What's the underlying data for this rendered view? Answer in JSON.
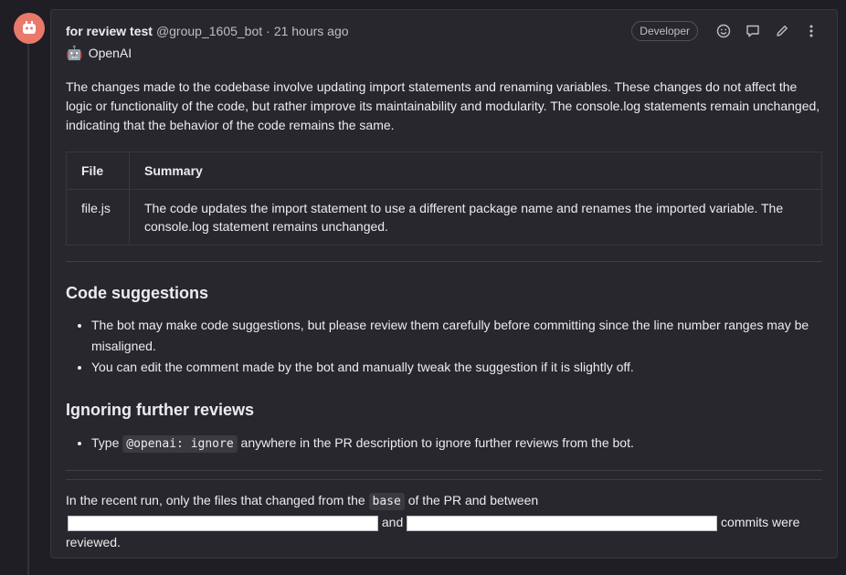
{
  "comment": {
    "author_name": "for review test",
    "author_handle": "@group_1605_bot",
    "separator": "·",
    "time": "21 hours ago",
    "role_badge": "Developer",
    "bot_emoji": "🤖",
    "bot_label": "OpenAI",
    "intro": "The changes made to the codebase involve updating import statements and renaming variables. These changes do not affect the logic or functionality of the code, but rather improve its maintainability and modularity. The console.log statements remain unchanged, indicating that the behavior of the code remains the same.",
    "table": {
      "headers": [
        "File",
        "Summary"
      ],
      "rows": [
        [
          "file.js",
          "The code updates the import statement to use a different package name and renames the imported variable. The console.log statement remains unchanged."
        ]
      ]
    },
    "code_suggestions": {
      "heading": "Code suggestions",
      "items": [
        "The bot may make code suggestions, but please review them carefully before committing since the line number ranges may be misaligned.",
        "You can edit the comment made by the bot and manually tweak the suggestion if it is slightly off."
      ]
    },
    "ignoring": {
      "heading": "Ignoring further reviews",
      "prefix": "Type",
      "code": "@openai: ignore",
      "suffix": "anywhere in the PR description to ignore further reviews from the bot."
    },
    "footer": {
      "part1": "In the recent run, only the files that changed from the",
      "code": "base",
      "part2": "of the PR and between",
      "and": "and",
      "part3": "commits were reviewed."
    }
  },
  "icons": [
    "avatar",
    "emoji-icon",
    "comment-icon",
    "pencil-icon",
    "kebab-icon"
  ],
  "colors": {
    "background": "#1f1e24",
    "card": "#28272d",
    "avatar": "#e9796b"
  }
}
